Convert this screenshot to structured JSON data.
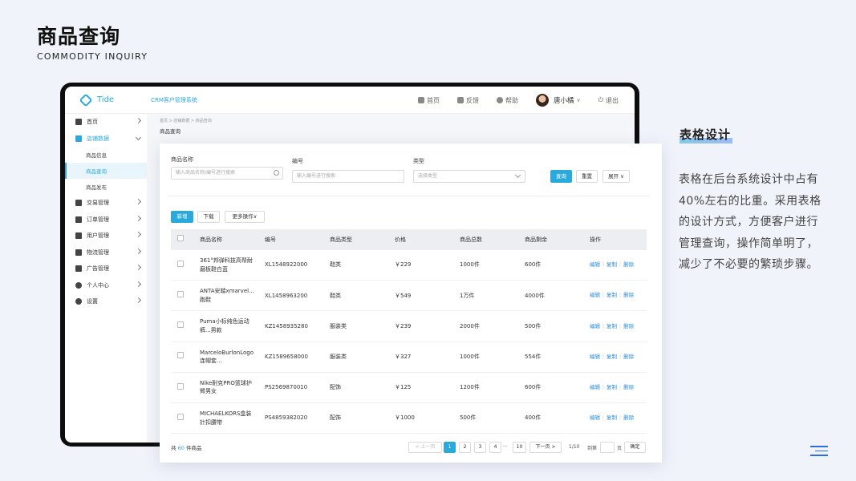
{
  "slide": {
    "title_cn": "商品查询",
    "title_en": "COMMODITY INQUIRY",
    "side_title": "表格设计",
    "side_body": "表格在后台系统设计中占有40%左右的比重。采用表格的设计方式，方便客户进行管理查询，操作简单明了，减少了不必要的繁琐步骤。"
  },
  "app": {
    "logo_text": "Tide",
    "system_name": "CRM客户管理系统",
    "topnav": {
      "home": "首页",
      "feedback": "反馈",
      "help": "帮助",
      "user": "唐小橘",
      "logout": "退出"
    },
    "sidebar": {
      "items": [
        {
          "label": "首页",
          "icon": "home-icon"
        },
        {
          "label": "店铺数据",
          "icon": "store-icon"
        },
        {
          "label": "交易管理",
          "icon": "trade-icon"
        },
        {
          "label": "订单管理",
          "icon": "order-icon"
        },
        {
          "label": "用户管理",
          "icon": "users-icon"
        },
        {
          "label": "物流管理",
          "icon": "truck-icon"
        },
        {
          "label": "广告管理",
          "icon": "ad-icon"
        },
        {
          "label": "个人中心",
          "icon": "person-icon"
        },
        {
          "label": "设置",
          "icon": "gear-icon"
        }
      ],
      "subitems": [
        "商品信息",
        "商品查询",
        "商品发布"
      ]
    },
    "breadcrumb": "首页 > 店铺数据 > 商品查询",
    "page_title": "商品查询"
  },
  "filters": {
    "name_label": "商品名称",
    "name_placeholder": "输入商品名称/编号进行搜索",
    "code_label": "编号",
    "code_placeholder": "输入编号进行搜索",
    "type_label": "类型",
    "type_placeholder": "选择类型",
    "query_btn": "查询",
    "reset_btn": "重置",
    "expand_btn": "展开"
  },
  "toolbar": {
    "add_btn": "新增",
    "download_btn": "下载",
    "more_btn": "更多操作"
  },
  "table": {
    "headers": [
      "商品名称",
      "编号",
      "商品类型",
      "价格",
      "商品总数",
      "商品剩余",
      "操作"
    ],
    "actions": {
      "edit": "编辑",
      "copy": "复制",
      "delete": "删除"
    },
    "rows": [
      {
        "name": "361°邦弹科技高帮耐磨板鞋白蓝",
        "code": "XL1548922000",
        "type": "鞋类",
        "price": "￥229",
        "total": "1000件",
        "remain": "600件"
      },
      {
        "name": "ANTA安踏xmarvel...跑鞋",
        "code": "XL1458963200",
        "type": "鞋类",
        "price": "￥549",
        "total": "1万件",
        "remain": "4000件"
      },
      {
        "name": "Puma小标纯色运动裤...男款",
        "code": "KZ1458935280",
        "type": "服装类",
        "price": "￥239",
        "total": "2000件",
        "remain": "500件"
      },
      {
        "name": "MarceloBurlonLogo连帽套...",
        "code": "KZ1589658000",
        "type": "服装类",
        "price": "￥327",
        "total": "1000件",
        "remain": "554件"
      },
      {
        "name": "Nike耐克PRO篮球护臂男女",
        "code": "PS2569870010",
        "type": "配饰",
        "price": "￥125",
        "total": "1200件",
        "remain": "600件"
      },
      {
        "name": "MICHAELKORS盒装针扣腰带",
        "code": "PS4859382020",
        "type": "配饰",
        "price": "￥1000",
        "total": "500件",
        "remain": "400件"
      }
    ]
  },
  "pagination": {
    "total_prefix": "共",
    "total_count": "60",
    "total_suffix": "件商品",
    "prev": "< 上一页",
    "pages": [
      "1",
      "2",
      "3",
      "4"
    ],
    "ellipsis": "···",
    "last": "10",
    "next": "下一页 >",
    "page_info": "1/10",
    "goto_label": "到第",
    "goto_suffix": "页",
    "confirm": "确定"
  }
}
